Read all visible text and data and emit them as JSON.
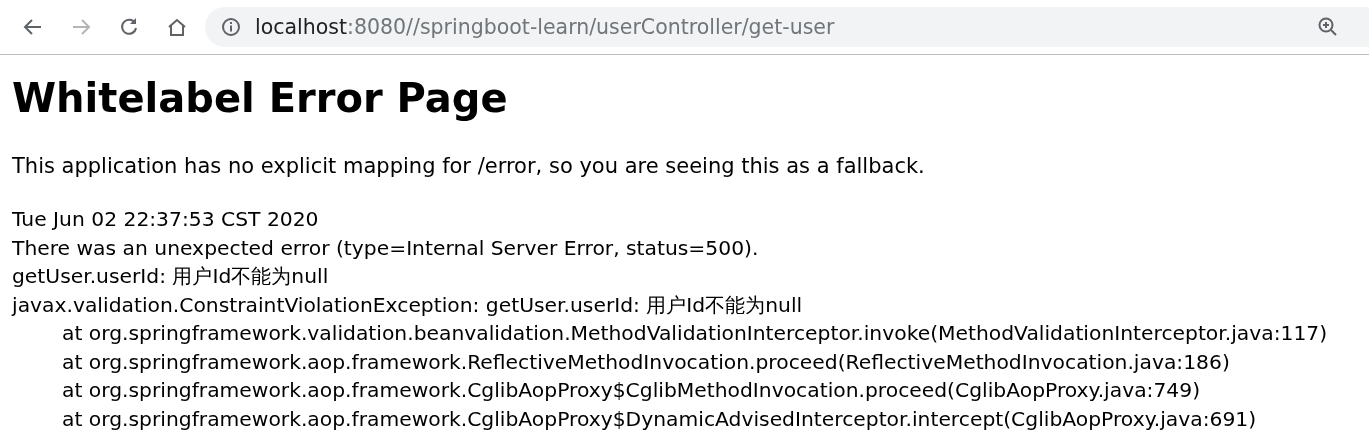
{
  "toolbar": {
    "back": {
      "disabled": false
    },
    "forward": {
      "disabled": true
    },
    "address": {
      "host": "localhost",
      "rest": ":8080//springboot-learn/userController/get-user"
    }
  },
  "page": {
    "title": "Whitelabel Error Page",
    "message": "This application has no explicit mapping for /error, so you are seeing this as a fallback.",
    "details": [
      "Tue Jun 02 22:37:53 CST 2020",
      "There was an unexpected error (type=Internal Server Error, status=500).",
      "getUser.userId: 用户Id不能为null",
      "javax.validation.ConstraintViolationException: getUser.userId: 用户Id不能为null"
    ],
    "stack_trace": [
      "at org.springframework.validation.beanvalidation.MethodValidationInterceptor.invoke(MethodValidationInterceptor.java:117)",
      "at org.springframework.aop.framework.ReflectiveMethodInvocation.proceed(ReflectiveMethodInvocation.java:186)",
      "at org.springframework.aop.framework.CglibAopProxy$CglibMethodInvocation.proceed(CglibAopProxy.java:749)",
      "at org.springframework.aop.framework.CglibAopProxy$DynamicAdvisedInterceptor.intercept(CglibAopProxy.java:691)"
    ]
  }
}
